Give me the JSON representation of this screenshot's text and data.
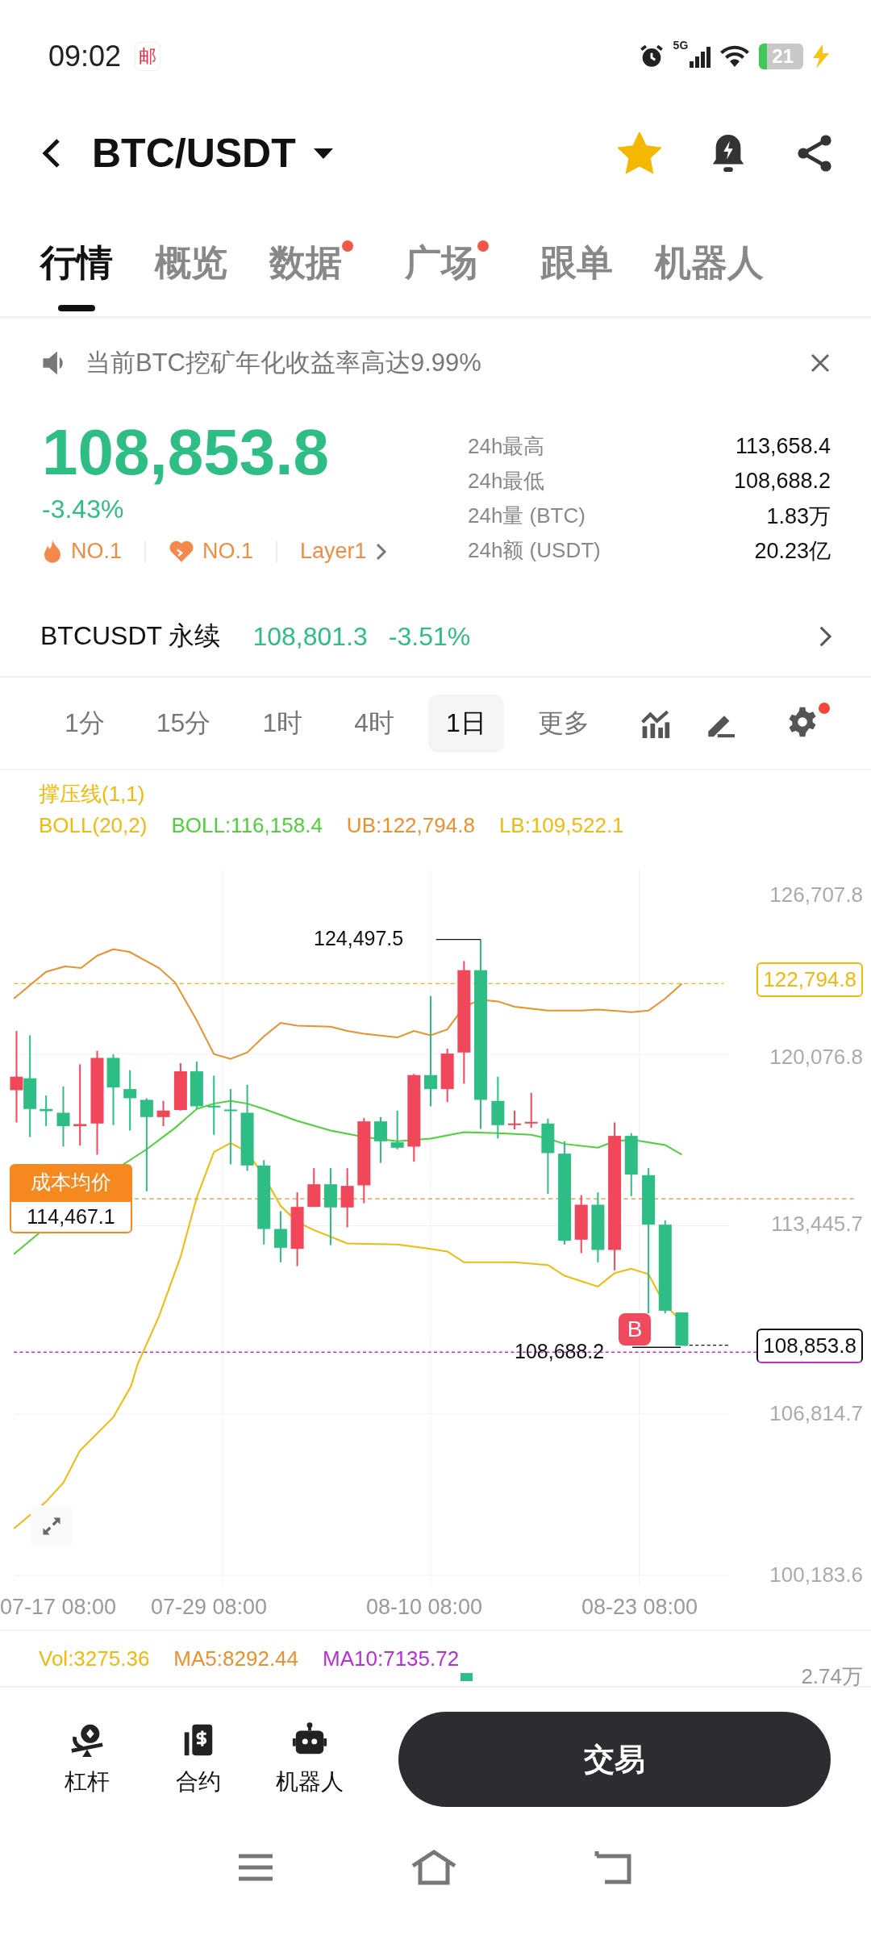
{
  "status_bar": {
    "time": "09:02",
    "app_badge": "邮",
    "network": "5G",
    "battery": "21"
  },
  "header": {
    "title": "BTC/USDT",
    "favorite": true
  },
  "tabs": [
    {
      "label": "行情",
      "selected": true,
      "dot": false
    },
    {
      "label": "概览",
      "selected": false,
      "dot": false
    },
    {
      "label": "数据",
      "selected": false,
      "dot": true
    },
    {
      "label": "广场",
      "selected": false,
      "dot": true
    },
    {
      "label": "跟单",
      "selected": false,
      "dot": false
    },
    {
      "label": "机器人",
      "selected": false,
      "dot": false
    }
  ],
  "notice": {
    "text": "当前BTC挖矿年化收益率高达9.99%"
  },
  "ticker": {
    "price": "108,853.8",
    "change": "-3.43%",
    "tags": [
      {
        "kind": "hot",
        "label": "NO.1"
      },
      {
        "kind": "heart",
        "label": "NO.1"
      },
      {
        "kind": "sector",
        "label": "Layer1"
      }
    ],
    "stats": [
      {
        "label": "24h最高",
        "value": "113,658.4"
      },
      {
        "label": "24h最低",
        "value": "108,688.2"
      },
      {
        "label": "24h量 (BTC)",
        "value": "1.83万"
      },
      {
        "label": "24h额 (USDT)",
        "value": "20.23亿"
      }
    ]
  },
  "perpetual": {
    "name": "BTCUSDT 永续",
    "price": "108,801.3",
    "change": "-3.51%"
  },
  "intervals": [
    {
      "label": "1分",
      "selected": false
    },
    {
      "label": "15分",
      "selected": false
    },
    {
      "label": "1时",
      "selected": false
    },
    {
      "label": "4时",
      "selected": false
    },
    {
      "label": "1日",
      "selected": true
    },
    {
      "label": "更多",
      "selected": false
    }
  ],
  "chart_tools": {
    "settings_dot": true
  },
  "chart": {
    "indicator": "撑压线(1,1)",
    "legend": [
      {
        "text": "BOLL(20,2)",
        "color": "#f0b90b"
      },
      {
        "text": "BOLL:116,158.4",
        "color": "#4cd137"
      },
      {
        "text": "UB:122,794.8",
        "color": "#e8912d"
      },
      {
        "text": "LB:109,522.1",
        "color": "#f0b90b"
      }
    ],
    "y_labels": [
      "126,707.8",
      "120,076.8",
      "113,445.7",
      "106,814.7",
      "100,183.6"
    ],
    "x_labels": [
      "07-17 08:00",
      "07-29 08:00",
      "08-10 08:00",
      "08-23 08:00"
    ],
    "high_label": "124,497.5",
    "low_label": "108,688.2",
    "band_price": "122,794.8",
    "last_price": "108,853.8",
    "cost_title": "成本均价",
    "cost_price": "114,467.1",
    "buy_marker": "B"
  },
  "volume": {
    "legend": [
      {
        "text": "Vol:3275.36",
        "color": "#f0b90b"
      },
      {
        "text": "MA5:8292.44",
        "color": "#e8912d"
      },
      {
        "text": "MA10:7135.72",
        "color": "#b62fd6"
      }
    ],
    "y_label": "2.74万"
  },
  "bottom_bar": {
    "actions": [
      {
        "kind": "leverage",
        "label": "杠杆"
      },
      {
        "kind": "contract",
        "label": "合约"
      },
      {
        "kind": "robot",
        "label": "机器人"
      }
    ],
    "trade_button": "交易"
  }
}
